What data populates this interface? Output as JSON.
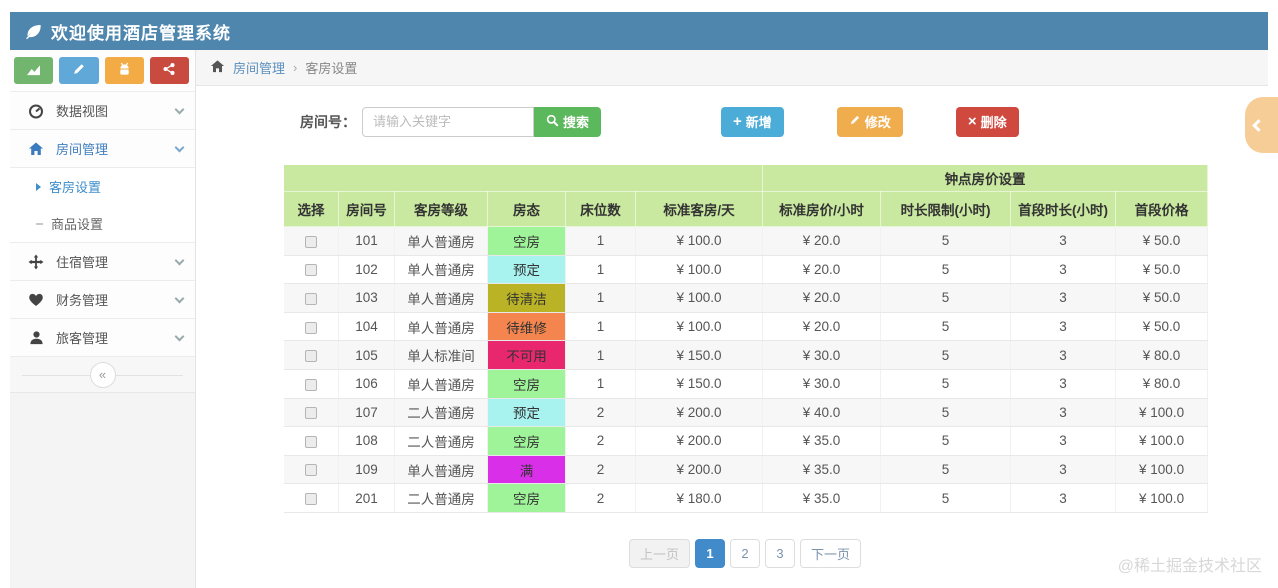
{
  "header": {
    "title": "欢迎使用酒店管理系统"
  },
  "breadcrumb": {
    "items": [
      "房间管理",
      "客房设置"
    ],
    "separator": "›"
  },
  "sidebar": {
    "quick_buttons": [
      {
        "icon": "area-chart-icon",
        "color": "#72b56e"
      },
      {
        "icon": "pencil-icon",
        "color": "#5fa8d8"
      },
      {
        "icon": "android-icon",
        "color": "#f3ab45"
      },
      {
        "icon": "share-icon",
        "color": "#c94a3e"
      }
    ],
    "menu": [
      {
        "label": "数据视图"
      },
      {
        "label": "房间管理"
      },
      {
        "label": "住宿管理"
      },
      {
        "label": "财务管理"
      },
      {
        "label": "旅客管理"
      }
    ],
    "submenu": [
      {
        "label": "客房设置",
        "active": true
      },
      {
        "label": "商品设置",
        "active": false
      }
    ],
    "collapse_glyph": "«"
  },
  "toolbar": {
    "search_label": "房间号：",
    "search_placeholder": "请输入关键字",
    "search_button": "搜索",
    "add_button": "新增",
    "edit_button": "修改",
    "delete_button": "删除"
  },
  "table": {
    "group_header": "钟点房价设置",
    "columns": [
      "选择",
      "房间号",
      "客房等级",
      "房态",
      "床位数",
      "标准客房/天",
      "标准房价/小时",
      "时长限制(小时)",
      "首段时长(小时)",
      "首段价格"
    ],
    "status_colors": {
      "空房": "#9ff399",
      "预定": "#a8f3f0",
      "待清洁": "#bab325",
      "待维修": "#f5854e",
      "不可用": "#e9276e",
      "满": "#d92fe8"
    },
    "rows": [
      {
        "room": "101",
        "grade": "单人普通房",
        "status": "空房",
        "beds": "1",
        "day_price": "¥ 100.0",
        "hour_price": "¥ 20.0",
        "limit": "5",
        "first_hours": "3",
        "first_price": "¥ 50.0"
      },
      {
        "room": "102",
        "grade": "单人普通房",
        "status": "预定",
        "beds": "1",
        "day_price": "¥ 100.0",
        "hour_price": "¥ 20.0",
        "limit": "5",
        "first_hours": "3",
        "first_price": "¥ 50.0"
      },
      {
        "room": "103",
        "grade": "单人普通房",
        "status": "待清洁",
        "beds": "1",
        "day_price": "¥ 100.0",
        "hour_price": "¥ 20.0",
        "limit": "5",
        "first_hours": "3",
        "first_price": "¥ 50.0"
      },
      {
        "room": "104",
        "grade": "单人普通房",
        "status": "待维修",
        "beds": "1",
        "day_price": "¥ 100.0",
        "hour_price": "¥ 20.0",
        "limit": "5",
        "first_hours": "3",
        "first_price": "¥ 50.0"
      },
      {
        "room": "105",
        "grade": "单人标准间",
        "status": "不可用",
        "beds": "1",
        "day_price": "¥ 150.0",
        "hour_price": "¥ 30.0",
        "limit": "5",
        "first_hours": "3",
        "first_price": "¥ 80.0"
      },
      {
        "room": "106",
        "grade": "单人普通房",
        "status": "空房",
        "beds": "1",
        "day_price": "¥ 150.0",
        "hour_price": "¥ 30.0",
        "limit": "5",
        "first_hours": "3",
        "first_price": "¥ 80.0"
      },
      {
        "room": "107",
        "grade": "二人普通房",
        "status": "预定",
        "beds": "2",
        "day_price": "¥ 200.0",
        "hour_price": "¥ 40.0",
        "limit": "5",
        "first_hours": "3",
        "first_price": "¥ 100.0"
      },
      {
        "room": "108",
        "grade": "二人普通房",
        "status": "空房",
        "beds": "2",
        "day_price": "¥ 200.0",
        "hour_price": "¥ 35.0",
        "limit": "5",
        "first_hours": "3",
        "first_price": "¥ 100.0"
      },
      {
        "room": "109",
        "grade": "单人普通房",
        "status": "满",
        "beds": "2",
        "day_price": "¥ 200.0",
        "hour_price": "¥ 35.0",
        "limit": "5",
        "first_hours": "3",
        "first_price": "¥ 100.0"
      },
      {
        "room": "201",
        "grade": "二人普通房",
        "status": "空房",
        "beds": "2",
        "day_price": "¥ 180.0",
        "hour_price": "¥ 35.0",
        "limit": "5",
        "first_hours": "3",
        "first_price": "¥ 100.0"
      }
    ]
  },
  "pagination": {
    "prev_label": "上一页",
    "next_label": "下一页",
    "pages": [
      "1",
      "2",
      "3"
    ],
    "active_page": "1"
  },
  "watermark": "@稀土掘金技术社区",
  "colors": {
    "topbar": "#4e86ae",
    "table_header": "#c9e8a0",
    "active_blue": "#428bca"
  }
}
